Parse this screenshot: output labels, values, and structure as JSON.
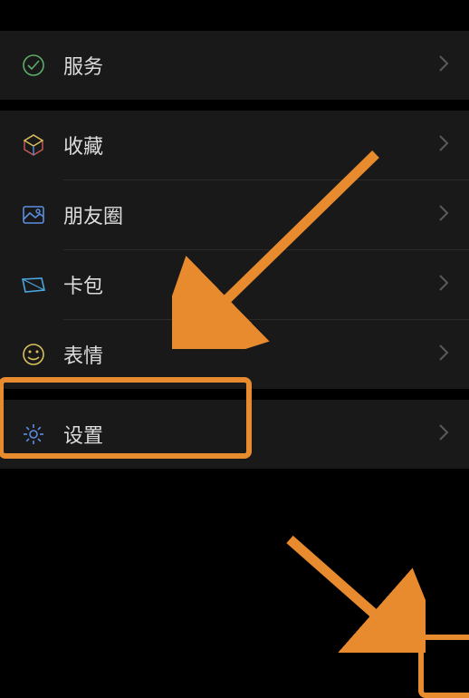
{
  "menu": {
    "group1": [
      {
        "label": "服务",
        "icon": "service"
      }
    ],
    "group2": [
      {
        "label": "收藏",
        "icon": "favorites"
      },
      {
        "label": "朋友圈",
        "icon": "moments"
      },
      {
        "label": "卡包",
        "icon": "cards"
      },
      {
        "label": "表情",
        "icon": "stickers"
      }
    ],
    "group3": [
      {
        "label": "设置",
        "icon": "settings"
      }
    ]
  },
  "colors": {
    "accent_arrow": "#e88b2f",
    "icon_green": "#5eae68",
    "icon_blue": "#5b8de0",
    "icon_cyan": "#4aa5e0",
    "icon_yellow": "#d8c05a"
  }
}
